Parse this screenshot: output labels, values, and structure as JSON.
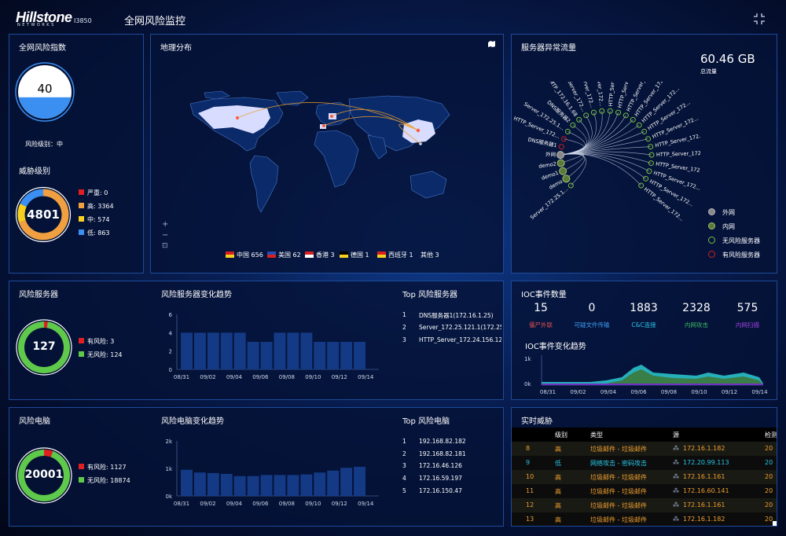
{
  "header": {
    "logo": "Hillstone",
    "logo_sub": "NETWORKS",
    "model": "I3850",
    "title": "全网风险监控"
  },
  "risk_index": {
    "title": "全网风险指数",
    "value": "40",
    "level_label": "风险级别：中",
    "fill_percent": 40
  },
  "threat_level": {
    "title": "威胁级别",
    "total": "4801",
    "items": [
      {
        "label": "严重: 0",
        "color": "#e02020",
        "value": 0
      },
      {
        "label": "高: 3364",
        "color": "#f0a040",
        "value": 3364
      },
      {
        "label": "中: 574",
        "color": "#f5d020",
        "value": 574
      },
      {
        "label": "低: 863",
        "color": "#3b8ff0",
        "value": 863
      }
    ]
  },
  "geo": {
    "title": "地理分布",
    "legend": [
      {
        "label": "中国  656"
      },
      {
        "label": "美国  62"
      },
      {
        "label": "香港  3"
      },
      {
        "label": "德国  1"
      },
      {
        "label": "西班牙  1"
      },
      {
        "label": "其他  3"
      }
    ]
  },
  "traffic": {
    "title": "服务器异常流量",
    "total": "60.46 GB",
    "total_label": "总流量",
    "nodes": [
      "Server_172.25.1...",
      "demo",
      "demo1",
      "demo2",
      "外网",
      "DNS服务器1",
      "HTTP_Server_172...",
      "Server_172.25.1...",
      "DNS服务器2",
      "SMTP_172.16.1.68",
      "HTTP_Server_172...",
      "HTTP_Server_172...",
      "HTTP_Server_172...",
      "HTTP_Server_172...",
      "HTTP_Server_172...",
      "HTTP_Server_172...",
      "HTTP_Server_172...",
      "HTTP_Server_172...",
      "HTTP_Server_172...",
      "HTTP_Server_172...",
      "HTTP_Server_172...",
      "HTTP_Server_172...",
      "HTTP_Server_172...",
      "HTTP_Server_172...",
      "HTTP_Server_172...",
      "HTTP_Server_172..."
    ],
    "legend": [
      {
        "label": "外网"
      },
      {
        "label": "内网"
      },
      {
        "label": "无风险服务器"
      },
      {
        "label": "有风险服务器"
      }
    ]
  },
  "risk_servers": {
    "title": "风险服务器",
    "total": "127",
    "legend": [
      {
        "label": "有风险: 3",
        "color": "#e02020"
      },
      {
        "label": "无风险: 124",
        "color": "#5ec94a"
      }
    ],
    "risky": 3,
    "safe": 124
  },
  "server_trend": {
    "title": "风险服务器变化趋势",
    "yticks": [
      "6",
      "4",
      "2",
      "0"
    ],
    "xticks": [
      "08/31",
      "09/02",
      "09/04",
      "09/06",
      "09/08",
      "09/10",
      "09/12",
      "09/14"
    ],
    "ymax": 6,
    "chart_data": {
      "type": "bar",
      "values": [
        4,
        4,
        4,
        4,
        4,
        3,
        3,
        4,
        4,
        4,
        3,
        3,
        3,
        3
      ],
      "ylim": [
        0,
        6
      ]
    }
  },
  "top_servers": {
    "title": "Top 风险服务器",
    "items": [
      {
        "rank": "1",
        "name": "DNS服务器1(172.16.1.25)"
      },
      {
        "rank": "2",
        "name": "Server_172.25.121.1(172.25..."
      },
      {
        "rank": "3",
        "name": "HTTP_Server_172.24.156.12("
      }
    ]
  },
  "ioc": {
    "title": "IOC事件数量",
    "stats": [
      {
        "value": "15",
        "label": "僵尸外联",
        "color": "#e05050"
      },
      {
        "value": "0",
        "label": "可疑文件传输",
        "color": "#3b9ff0"
      },
      {
        "value": "1883",
        "label": "C&C连接",
        "color": "#29c7e8"
      },
      {
        "value": "2328",
        "label": "内网攻击",
        "color": "#3cb860"
      },
      {
        "value": "575",
        "label": "内网扫描",
        "color": "#a040e0"
      }
    ],
    "trend_title": "IOC事件变化趋势",
    "yticks": [
      "1k",
      "0k"
    ],
    "xticks": [
      "08/31",
      "09/02",
      "09/04",
      "09/06",
      "09/08",
      "09/10",
      "09/12",
      "09/14"
    ]
  },
  "risk_pcs": {
    "title": "风险电脑",
    "total": "20001",
    "legend": [
      {
        "label": "有风险: 1127",
        "color": "#e02020"
      },
      {
        "label": "无风险: 18874",
        "color": "#5ec94a"
      }
    ],
    "risky": 1127,
    "safe": 18874
  },
  "pc_trend": {
    "title": "风险电脑变化趋势",
    "yticks": [
      "2k",
      "1k",
      "0k"
    ],
    "xticks": [
      "08/31",
      "09/02",
      "09/04",
      "09/06",
      "09/08",
      "09/10",
      "09/12",
      "09/14"
    ],
    "ymax": 2000,
    "chart_data": {
      "type": "bar",
      "values": [
        950,
        850,
        830,
        800,
        720,
        720,
        760,
        760,
        760,
        780,
        850,
        920,
        1020,
        1060
      ],
      "ylim": [
        0,
        2000
      ]
    }
  },
  "top_pcs": {
    "title": "Top 风险电脑",
    "items": [
      {
        "rank": "1",
        "name": "192.168.82.182"
      },
      {
        "rank": "2",
        "name": "192.168.82.181"
      },
      {
        "rank": "3",
        "name": "172.16.46.126"
      },
      {
        "rank": "4",
        "name": "172.16.59.197"
      },
      {
        "rank": "5",
        "name": "172.16.150.47"
      }
    ]
  },
  "realtime": {
    "title": "实时威胁",
    "headers": [
      "级别",
      "类型",
      "源",
      "检测"
    ],
    "rows": [
      {
        "id": "8",
        "level": "高",
        "type": "垃圾邮件 - 垃圾邮件",
        "src": "172.16.1.182",
        "det": "20",
        "color": "#f0a030"
      },
      {
        "id": "9",
        "level": "低",
        "type": "网络攻击 - 密码攻击",
        "src": "172.20.99.113",
        "det": "20",
        "color": "#29c7e8"
      },
      {
        "id": "10",
        "level": "高",
        "type": "垃圾邮件 - 垃圾邮件",
        "src": "172.16.1.161",
        "det": "20",
        "color": "#f0a030"
      },
      {
        "id": "11",
        "level": "高",
        "type": "垃圾邮件 - 垃圾邮件",
        "src": "172.16.60.141",
        "det": "20",
        "color": "#f0a030"
      },
      {
        "id": "12",
        "level": "高",
        "type": "垃圾邮件 - 垃圾邮件",
        "src": "172.16.1.161",
        "det": "20",
        "color": "#f0a030"
      },
      {
        "id": "13",
        "level": "高",
        "type": "垃圾邮件 - 垃圾邮件",
        "src": "172.16.1.182",
        "det": "20",
        "color": "#f0a030"
      }
    ]
  }
}
